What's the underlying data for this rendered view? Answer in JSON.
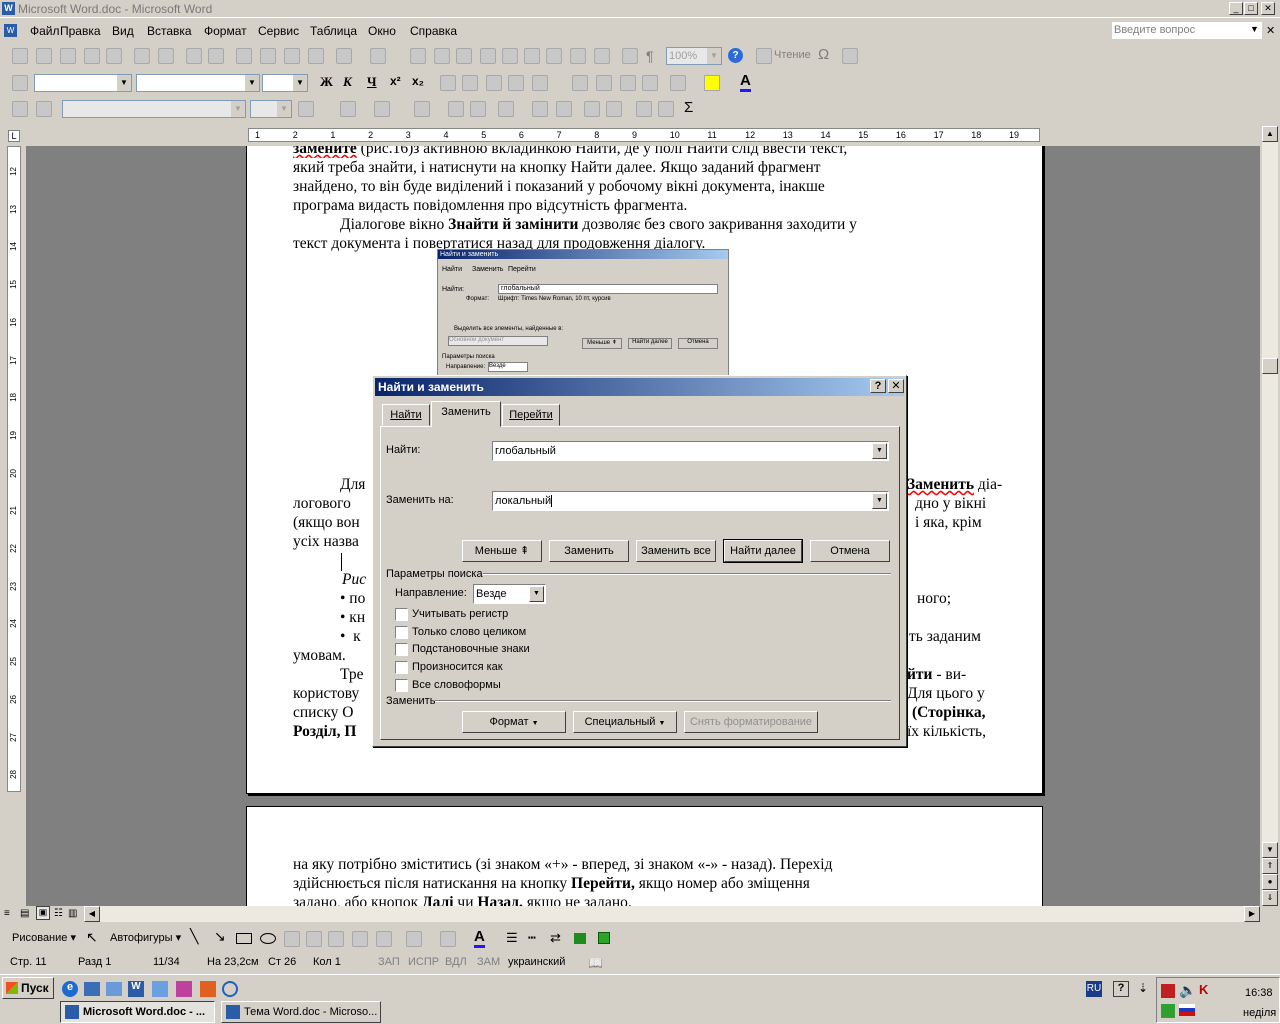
{
  "window": {
    "title": "Microsoft Word.doc - Microsoft Word"
  },
  "menubar": {
    "items": [
      "Файл",
      "Правка",
      "Вид",
      "Вставка",
      "Формат",
      "Сервис",
      "Таблица",
      "Окно",
      "Справка"
    ],
    "help_placeholder": "Введите вопрос"
  },
  "toolbar": {
    "zoom": "100%",
    "reading": "Чтение"
  },
  "document": {
    "p1_line0": "замените (рис.16)з активною вкладинкою Найти, де у полі Найти слід ввести текст,",
    "p1_line1": "який треба знайти, і натиснути на кнопку Найти далее. Якщо заданий фрагмент",
    "p1_line2": "знайдено, то він буде виділений і показаний у робочому вікні документа, інакше",
    "p1_line3": "програма видасть повідомлення про відсутність фрагмента.",
    "p2_line0_a": "Діалогове вікно ",
    "p2_line0_b": "Знайти й замінити",
    "p2_line0_c": " дозволяє без свого закривання заходити у",
    "p2_line1": "текст документа і повертатися назад для продовження діалогу.",
    "p3_left0": "Для",
    "p3_right0": "Заменить",
    "p3_right0b": " діа-",
    "p3_left1": "логового",
    "p3_right1": "дно у вікні",
    "p3_left2": "(якщо вон",
    "p3_right2": "і яка, крім",
    "p3_left3": "усіх назва",
    "caption": "Рис",
    "bul1_l": "• по",
    "bul1_r": "ного;",
    "bul2_l": "• кн",
    "bul3_l": "•  к",
    "bul3_r": "ть заданим",
    "bul3_l2": "умовам.",
    "p4_l0": "Тре",
    "p4_r0": "йти",
    "p4_r0b": " - ви-",
    "p4_l1": "користову",
    "p4_r1": "Для цього у",
    "p4_l2": "списку О",
    "p4_r2": "(Сторінка,",
    "p4_l3": "Розділ, П",
    "p4_r3": "їх кількість,",
    "page2_line0": "на яку потрібно зміститись (зі знаком «+» - вперед, зі знаком «-» - назад). Перехід",
    "page2_line1_a": "здійснюється після натискання на кнопку ",
    "page2_line1_b": "Перейти,",
    "page2_line1_c": " якщо номер або зміщення",
    "page2_line2_a": "задано, або кнопок ",
    "page2_line2_b": "Далі",
    "page2_line2_c": " чи ",
    "page2_line2_d": "Назад,",
    "page2_line2_e": " якщо не задано."
  },
  "thumbnail": {
    "title": "Найти и заменить",
    "tabs": [
      "Найти",
      "Заменить",
      "Перейти"
    ],
    "find_label": "Найти:",
    "find_value": "глобальный",
    "format_label": "Формат:",
    "format_value": "Шрифт: Times New Roman, 10 пт, курсив",
    "highlight": "Выделить все элементы, найденные в:",
    "main_doc": "Основной документ",
    "btn_less": "Меньше ⇞",
    "btn_next": "Найти далее",
    "btn_cancel": "Отмена",
    "params": "Параметры поиска",
    "direction": "Направление:",
    "direction_value": "Везде"
  },
  "dialog": {
    "title": "Найти и заменить",
    "tabs": [
      "Найти",
      "Заменить",
      "Перейти"
    ],
    "find_label": "Найти:",
    "find_value": "глобальный",
    "replace_label": "Заменить на:",
    "replace_value": "локальный",
    "btn_less": "Меньше",
    "btn_replace": "Заменить",
    "btn_replace_all": "Заменить все",
    "btn_find_next": "Найти далее",
    "btn_cancel": "Отмена",
    "params_label": "Параметры поиска",
    "direction_label": "Направление:",
    "direction_value": "Везде",
    "options": [
      "Учитывать регистр",
      "Только слово целиком",
      "Подстановочные знаки",
      "Произносится как",
      "Все словоформы"
    ],
    "replace_section": "Заменить",
    "btn_format": "Формат",
    "btn_special": "Специальный",
    "btn_no_format": "Снять форматирование"
  },
  "drawbar": {
    "drawing": "Рисование",
    "autoshapes": "Автофигуры"
  },
  "status": {
    "page": "Стр. 11",
    "section": "Разд 1",
    "pages": "11/34",
    "at": "На 23,2см",
    "line": "Ст 26",
    "col": "Кол 1",
    "rec": "ЗАП",
    "trk": "ИСПР",
    "ext": "ВДЛ",
    "ovr": "ЗАМ",
    "lang": "украинский"
  },
  "taskbar": {
    "start": "Пуск",
    "tasks": [
      "Microsoft Word.doc - ...",
      "Тема Word.doc - Microso..."
    ],
    "lang": "RU",
    "time": "16:38",
    "day": "неділя"
  },
  "ruler_numbers": [
    "1",
    "2",
    "1",
    "2",
    "3",
    "4",
    "5",
    "6",
    "7",
    "8",
    "9",
    "10",
    "11",
    "12",
    "13",
    "14",
    "15",
    "16",
    "17",
    "18",
    "19"
  ],
  "ruler_v_numbers": [
    "12",
    "13",
    "14",
    "15",
    "16",
    "17",
    "18",
    "19",
    "20",
    "21",
    "22",
    "23",
    "24",
    "25",
    "26",
    "27",
    "28"
  ]
}
